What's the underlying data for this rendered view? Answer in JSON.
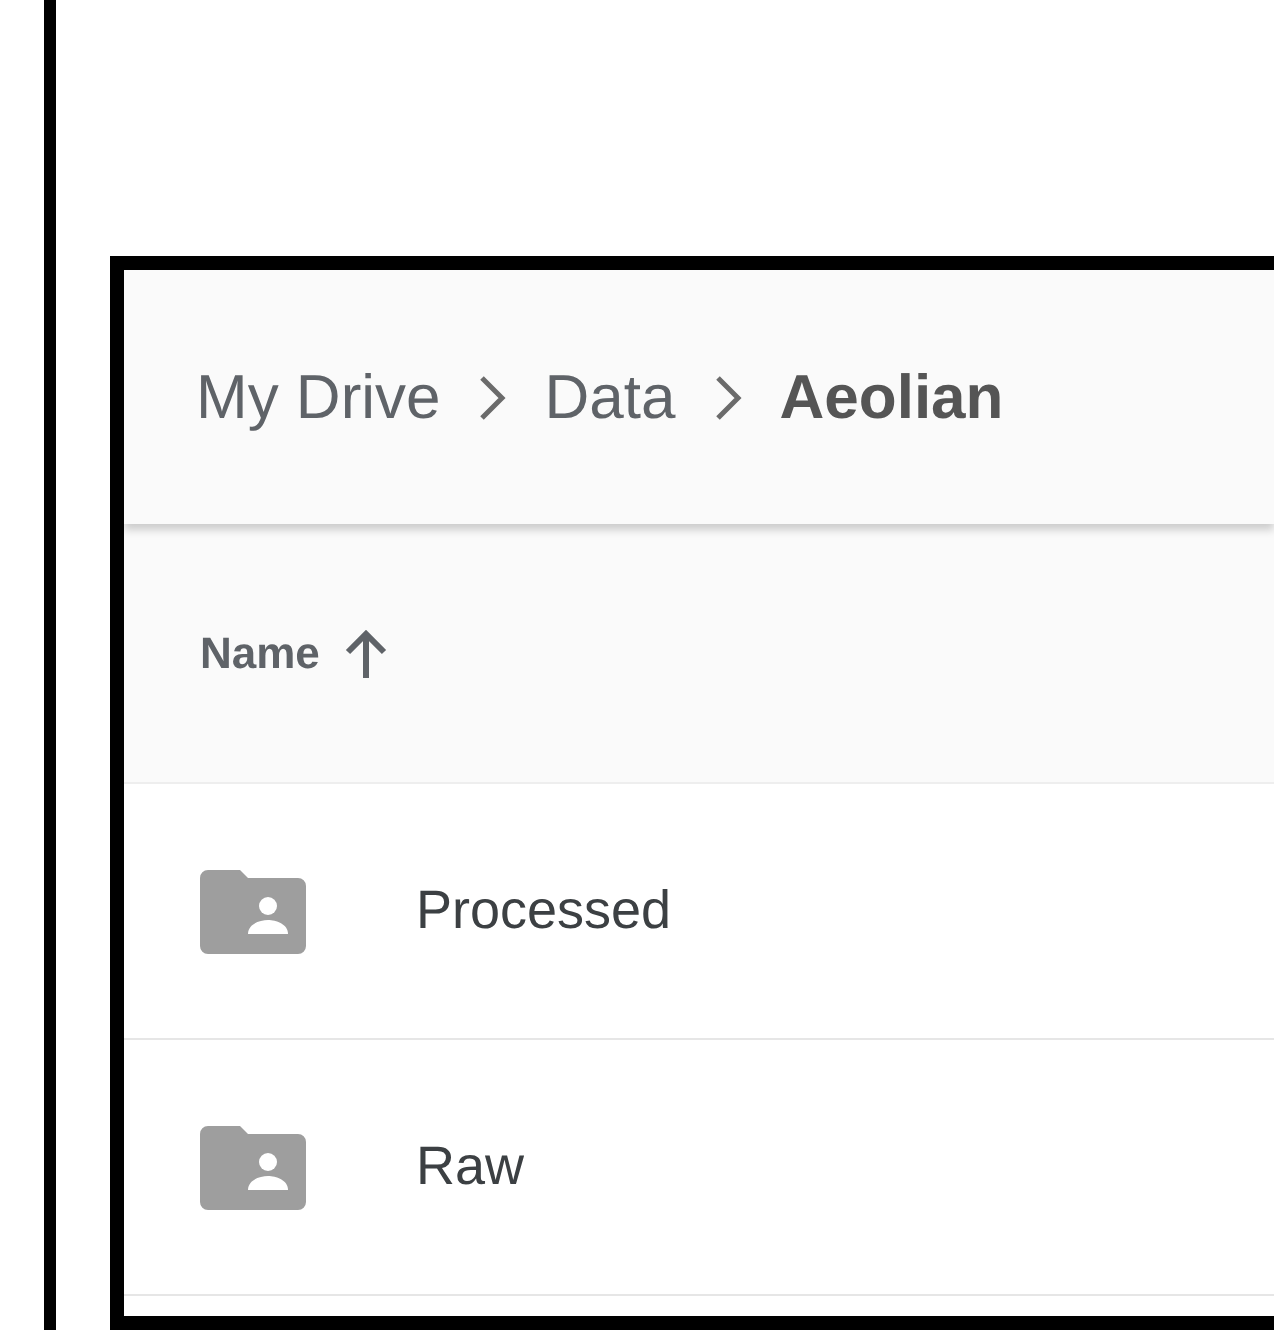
{
  "breadcrumb": [
    {
      "label": "My Drive",
      "current": false
    },
    {
      "label": "Data",
      "current": false
    },
    {
      "label": "Aeolian",
      "current": true
    }
  ],
  "table": {
    "columns": [
      {
        "label": "Name",
        "sort_ascending": true
      }
    ],
    "rows": [
      {
        "name": "Processed",
        "kind": "shared-folder"
      },
      {
        "name": "Raw",
        "kind": "shared-folder"
      }
    ]
  }
}
